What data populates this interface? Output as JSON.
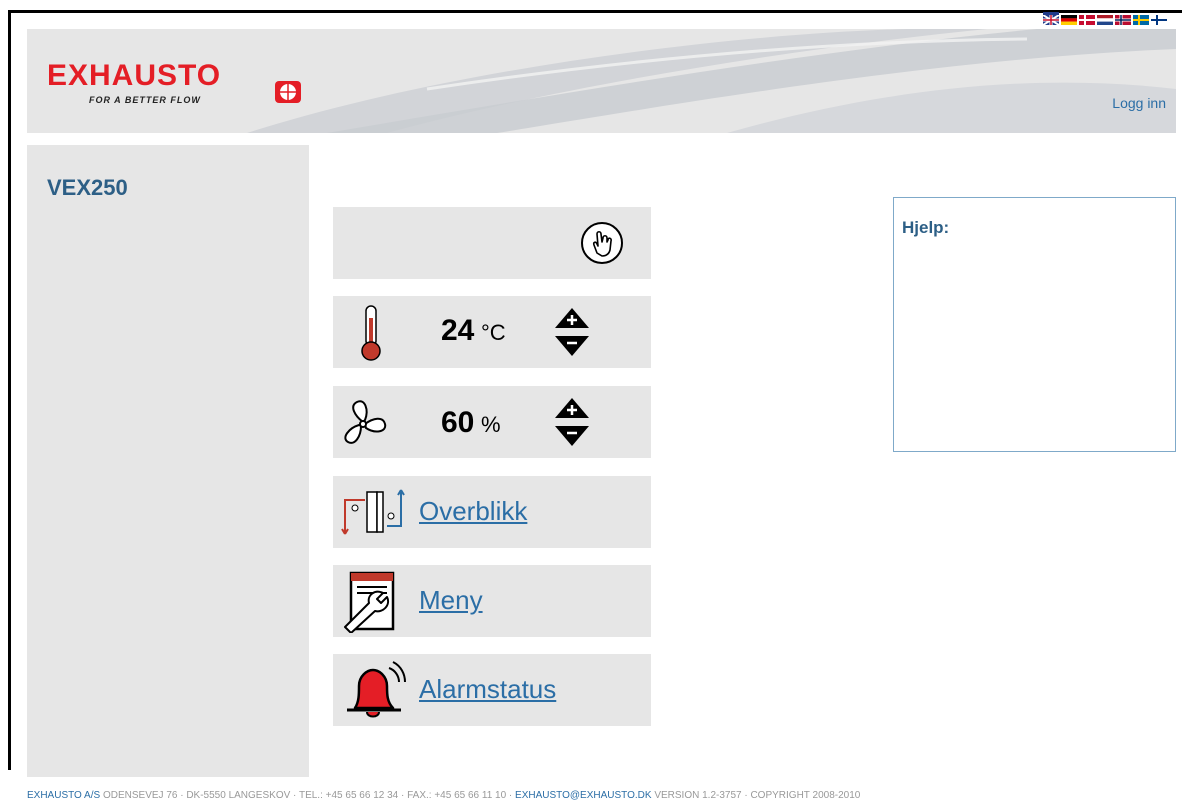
{
  "header": {
    "brand": "EXHAUSTO",
    "tagline": "FOR A BETTER FLOW",
    "login_label": "Logg inn"
  },
  "language_flags": [
    "english-flag",
    "german-flag",
    "danish-flag",
    "dutch-flag",
    "norwegian-flag",
    "swedish-flag",
    "finnish-flag"
  ],
  "sidebar": {
    "device_name": "VEX250"
  },
  "controls": {
    "mode_icon": "hand-touch-icon",
    "temperature": {
      "value": "24",
      "unit": "°C"
    },
    "fan": {
      "value": "60",
      "unit": "%"
    }
  },
  "nav": {
    "overview_label": "Overblikk",
    "menu_label": "Meny",
    "alarm_label": "Alarmstatus"
  },
  "help": {
    "title": "Hjelp:"
  },
  "footer": {
    "company": "EXHAUSTO A/S",
    "address": "ODENSEVEJ 76 · DK-5550 LANGESKOV · TEL.: +45 65 66 12 34 · FAX.: +45 65 66 11 10 ·",
    "email": "EXHAUSTO@EXHAUSTO.DK",
    "version": "VERSION 1.2-3757 · COPYRIGHT 2008-2010"
  },
  "colors": {
    "brand_red": "#e41e26",
    "link_blue": "#2b6ea6",
    "panel_gray": "#e6e6e6"
  }
}
